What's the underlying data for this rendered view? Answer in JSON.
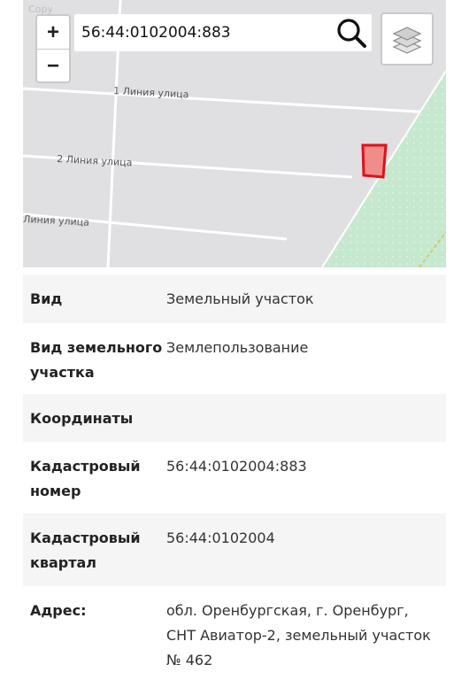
{
  "map": {
    "search": {
      "value": "56:44:0102004:883",
      "placeholder": ""
    },
    "zoom": {
      "in_label": "+",
      "out_label": "−"
    },
    "streets": [
      "1 Линия улица",
      "2 Линия улица",
      "Линия улица"
    ],
    "watermark": "Copy",
    "colors": {
      "background": "#e0e0e3",
      "park": "#c6e8cf",
      "parcel_outline": "#e0101a",
      "parcel_fill": "#f08c8c"
    },
    "icons": {
      "search": "search-icon",
      "layers": "layers-icon"
    }
  },
  "parcel": {
    "rows": [
      {
        "key": "Вид",
        "value": "Земельный участок"
      },
      {
        "key": "Вид земельного участка",
        "value": "Землепользование"
      },
      {
        "key": "Координаты",
        "value": ""
      },
      {
        "key": "Кадастровый номер",
        "value": "56:44:0102004:883"
      },
      {
        "key": "Кадастровый квартал",
        "value": "56:44:0102004"
      },
      {
        "key": "Адрес:",
        "value": "обл. Оренбургская, г. Оренбург, СНТ Авиатор-2, земельный участок № 462"
      }
    ]
  }
}
